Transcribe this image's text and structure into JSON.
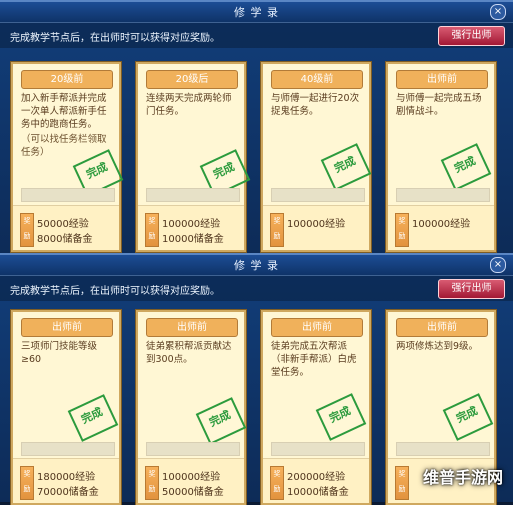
{
  "top_panel": {
    "title": "修 学 录",
    "close_icon": "close-icon",
    "instruction": "完成教学节点后，在出师时可以获得对应奖励。",
    "force_button": "强行出师",
    "cards": [
      {
        "badge": "20级前",
        "description": "加入新手帮派并完成一次单人帮派新手任务中的跑商任务。",
        "sub_description": "（可以找任务栏领取任务）",
        "stamp": "完成",
        "rewards": [
          "50000经验",
          "8000储备金"
        ]
      },
      {
        "badge": "20级后",
        "description": "连续两天完成两轮师门任务。",
        "sub_description": "",
        "stamp": "完成",
        "rewards": [
          "100000经验",
          "10000储备金"
        ]
      },
      {
        "badge": "40级前",
        "description": "与师傅一起进行20次捉鬼任务。",
        "sub_description": "",
        "stamp": "完成",
        "rewards": [
          "100000经验",
          ""
        ]
      },
      {
        "badge": "出师前",
        "description": "与师傅一起完成五场剧情战斗。",
        "sub_description": "",
        "stamp": "完成",
        "rewards": [
          "100000经验",
          ""
        ]
      }
    ]
  },
  "bottom_panel": {
    "title": "修 学 录",
    "close_icon": "close-icon",
    "instruction": "完成教学节点后，在出师时可以获得对应奖励。",
    "force_button": "强行出师",
    "cards": [
      {
        "badge": "出师前",
        "description": "三项师门技能等级≥60",
        "sub_description": "",
        "stamp": "完成",
        "rewards": [
          "180000经验",
          "70000储备金"
        ]
      },
      {
        "badge": "出师前",
        "description": "徒弟累积帮派贡献达到300点。",
        "sub_description": "",
        "stamp": "完成",
        "rewards": [
          "100000经验",
          "50000储备金"
        ]
      },
      {
        "badge": "出师前",
        "description": "徒弟完成五次帮派（非新手帮派）白虎堂任务。",
        "sub_description": "",
        "stamp": "完成",
        "rewards": [
          "200000经验",
          "10000储备金"
        ]
      },
      {
        "badge": "出师前",
        "description": "两项修炼达到9级。",
        "sub_description": "",
        "stamp": "完成",
        "rewards": [
          "",
          ""
        ]
      }
    ]
  },
  "watermark": "维普手游网"
}
